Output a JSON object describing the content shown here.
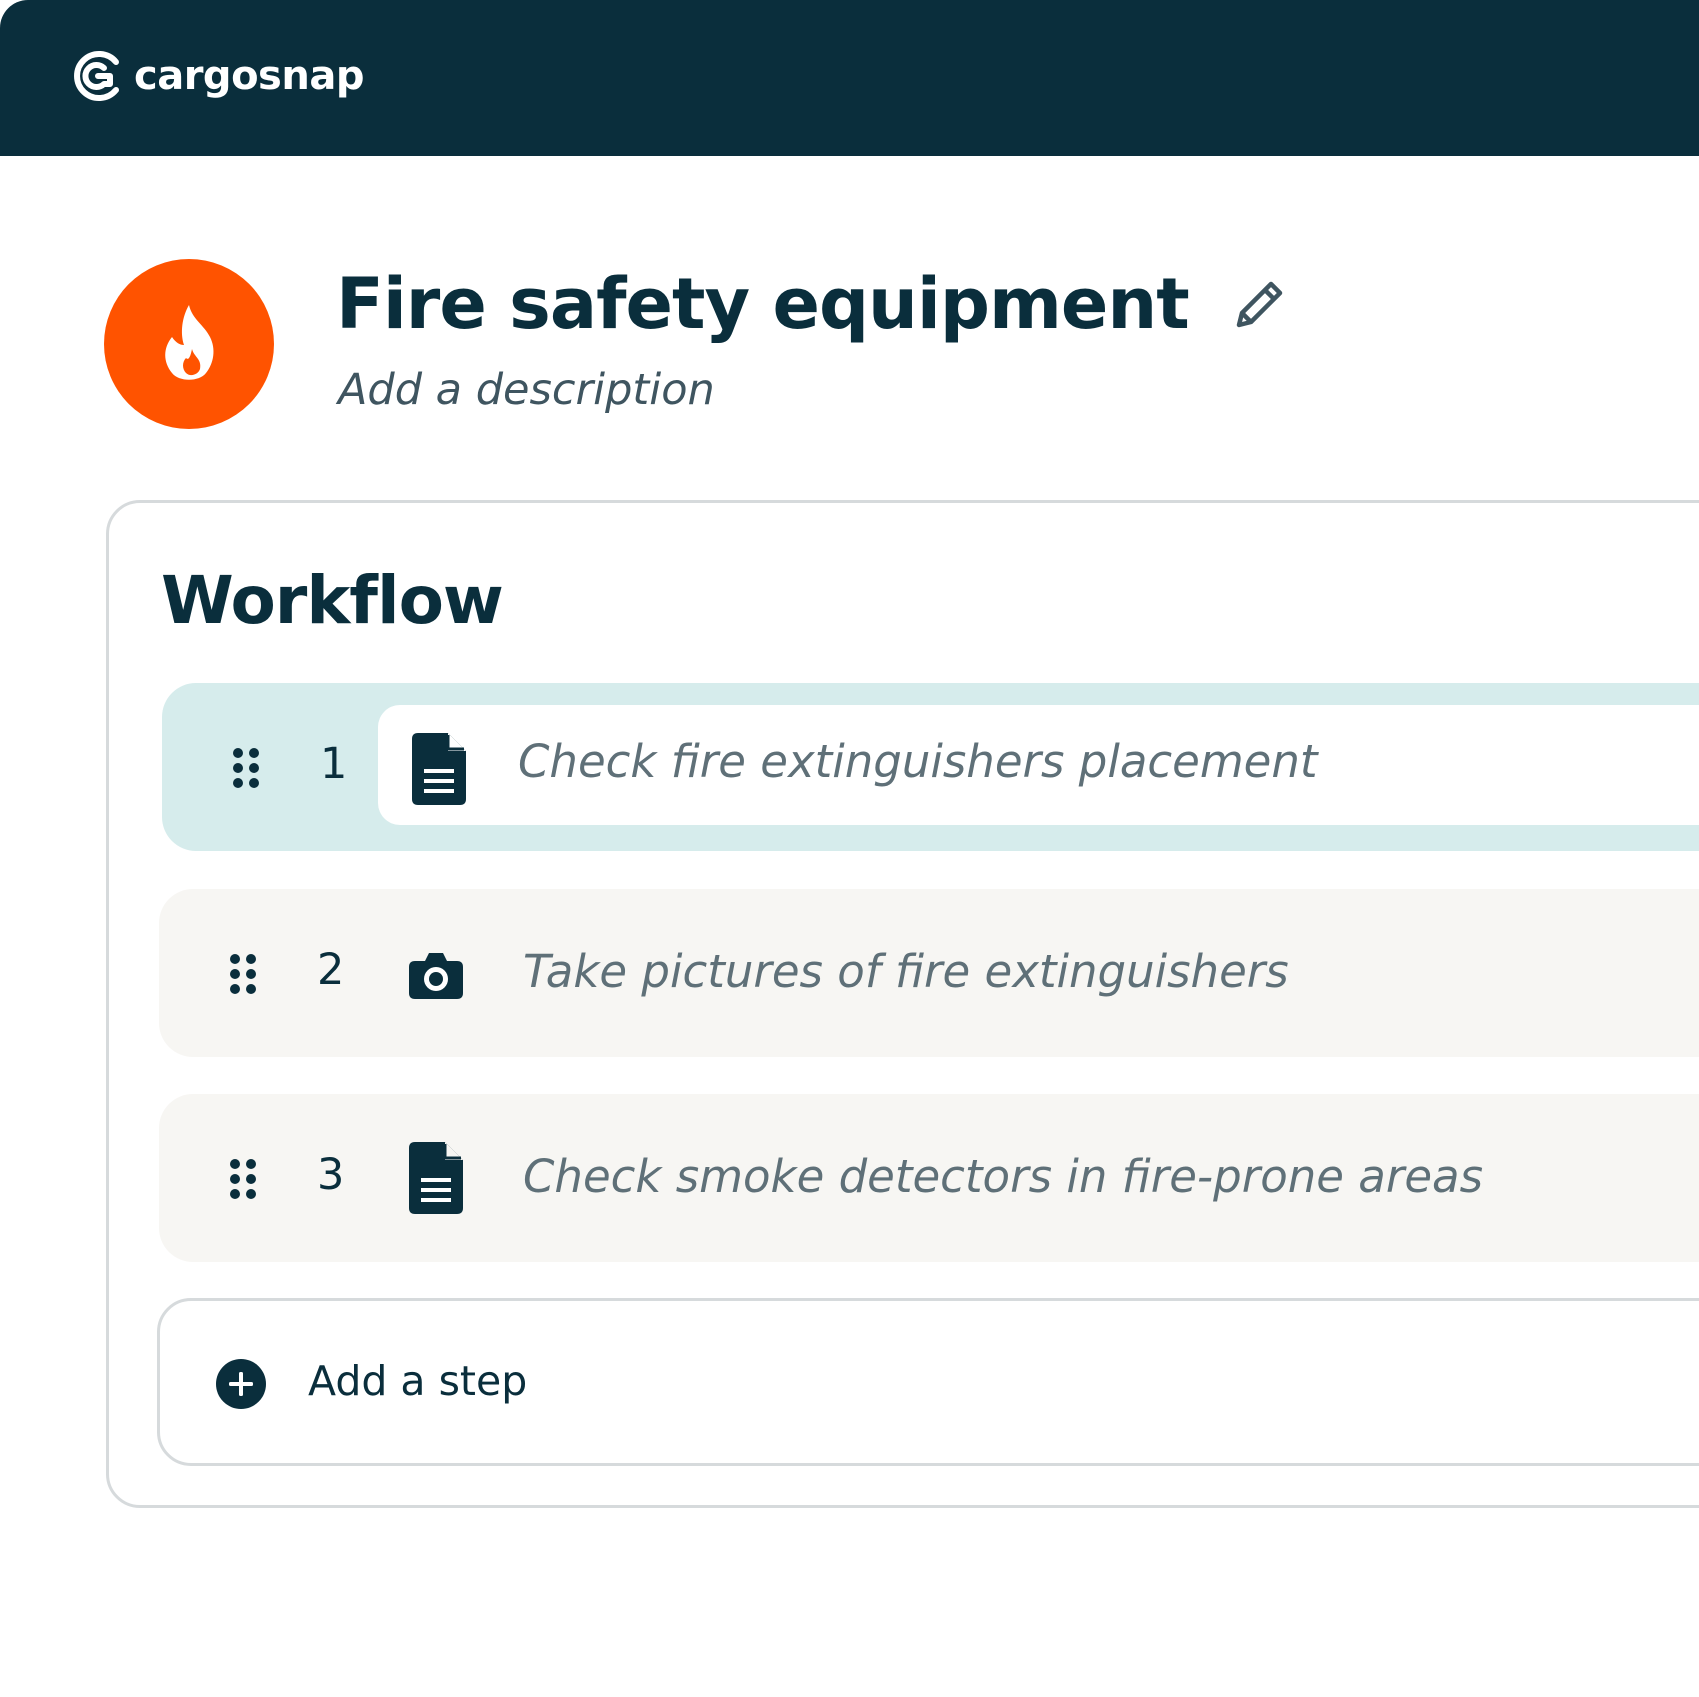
{
  "brand": {
    "name": "cargosnap"
  },
  "colors": {
    "topbar": "#0a2e3c",
    "accent": "#ff5300",
    "active_step": "#d6ecec",
    "step": "#f7f6f3",
    "text_muted": "#5f7078"
  },
  "header": {
    "title": "Fire safety equipment",
    "description_placeholder": "Add a description",
    "avatar_icon": "flame-icon",
    "edit_icon": "pencil-icon"
  },
  "workflow": {
    "title": "Workflow",
    "steps": [
      {
        "number": "1",
        "icon": "document-icon",
        "text": "Check fire extinguishers placement",
        "active": true
      },
      {
        "number": "2",
        "icon": "camera-icon",
        "text": "Take pictures of fire extinguishers",
        "active": false
      },
      {
        "number": "3",
        "icon": "document-icon",
        "text": "Check smoke detectors in fire-prone areas",
        "active": false
      }
    ],
    "add_step_label": "Add a step",
    "add_step_icon": "plus-circle-icon"
  }
}
